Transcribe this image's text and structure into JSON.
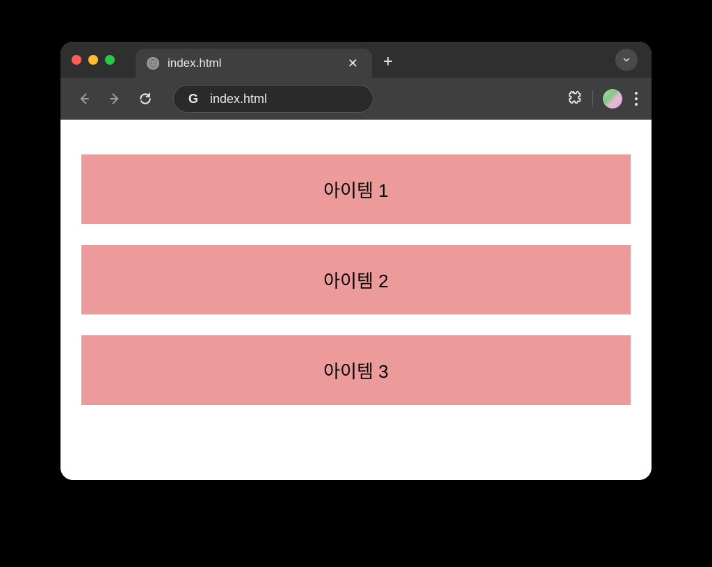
{
  "browser": {
    "tab_title": "index.html",
    "address": "index.html"
  },
  "content": {
    "items": [
      {
        "label": "아이템 1"
      },
      {
        "label": "아이템 2"
      },
      {
        "label": "아이템 3"
      }
    ]
  }
}
